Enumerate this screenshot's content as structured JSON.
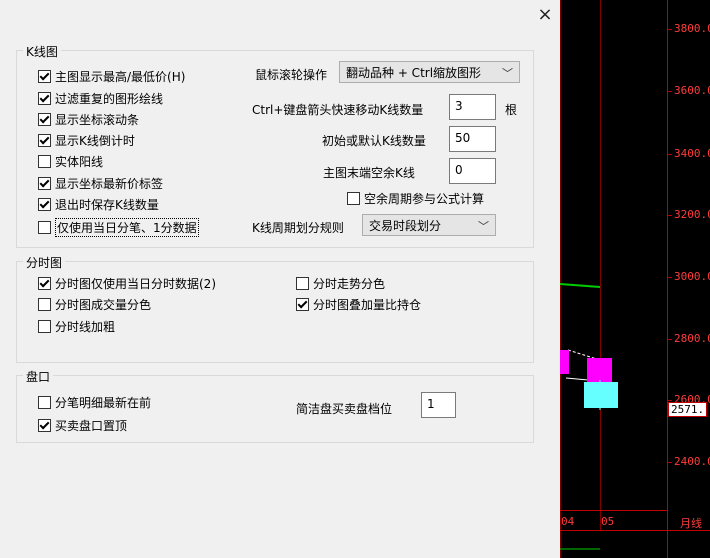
{
  "chart": {
    "y_ticks": [
      "3800.0",
      "3600.0",
      "3400.0",
      "3200.0",
      "3000.0",
      "2800.0",
      "2600.0",
      "2400.0"
    ],
    "price_tag": "2571.",
    "x_labels": [
      "04",
      "05",
      "月线"
    ],
    "colors": {
      "axis": "#c00000",
      "up": "#ff00ff",
      "down": "#66ffff",
      "ma": "#00cc00"
    }
  },
  "dialog": {
    "close_label": "×",
    "kline": {
      "title": "K线图",
      "checks": [
        {
          "label": "主图显示最高/最低价(H)",
          "checked": true
        },
        {
          "label": "过滤重复的图形绘线",
          "checked": true
        },
        {
          "label": "显示坐标滚动条",
          "checked": true
        },
        {
          "label": "显示K线倒计时",
          "checked": true
        },
        {
          "label": "实体阳线",
          "checked": false
        },
        {
          "label": "显示坐标最新价标签",
          "checked": true
        },
        {
          "label": "退出时保存K线数量",
          "checked": true
        },
        {
          "label": "仅使用当日分笔、1分数据",
          "checked": false
        }
      ],
      "wheel_label": "鼠标滚轮操作",
      "wheel_value": "翻动品种 + Ctrl缩放图形",
      "ctrl_label": "Ctrl+键盘箭头快速移动K线数量",
      "ctrl_value": "3",
      "ctrl_unit": "根",
      "default_label": "初始或默认K线数量",
      "default_value": "50",
      "empty_label": "主图末端空余K线",
      "empty_value": "0",
      "empty_period_label": "空余周期参与公式计算",
      "empty_period_checked": false,
      "period_label": "K线周期划分规则",
      "period_value": "交易时段划分"
    },
    "intraday": {
      "title": "分时图",
      "checks_left": [
        {
          "label": "分时图仅使用当日分时数据(2)",
          "checked": true
        },
        {
          "label": "分时图成交量分色",
          "checked": false
        },
        {
          "label": "分时线加粗",
          "checked": false
        }
      ],
      "checks_right": [
        {
          "label": "分时走势分色",
          "checked": false
        },
        {
          "label": "分时图叠加量比持仓",
          "checked": true
        }
      ]
    },
    "book": {
      "title": "盘口",
      "checks": [
        {
          "label": "分笔明细最新在前",
          "checked": false
        },
        {
          "label": "买卖盘口置顶",
          "checked": true
        }
      ],
      "levels_label": "简洁盘买卖盘档位",
      "levels_value": "1"
    }
  }
}
